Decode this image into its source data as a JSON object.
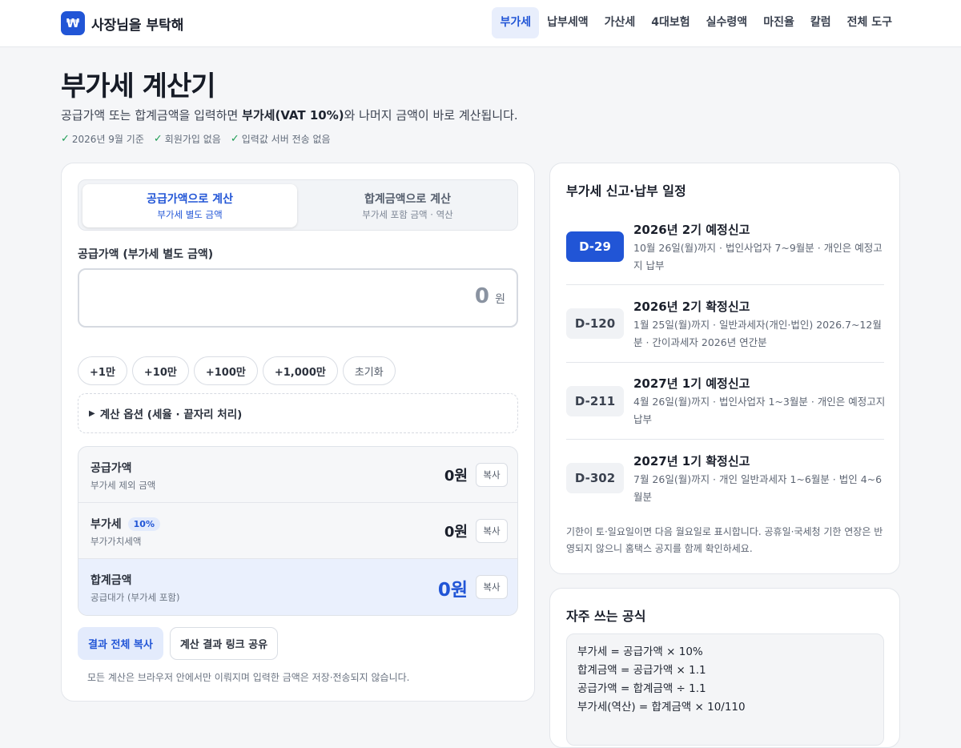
{
  "header": {
    "logo_glyph": "₩",
    "brand_name": "사장님을 부탁해",
    "nav": [
      "부가세",
      "납부세액",
      "가산세",
      "4대보험",
      "실수령액",
      "마진율",
      "칼럼",
      "전체 도구"
    ],
    "active_nav": "부가세"
  },
  "intro": {
    "title": "부가세 계산기",
    "desc_pre": "공급가액 또는 합계금액을 입력하면 ",
    "desc_bold": "부가세(VAT 10%)",
    "desc_post": "와 나머지 금액이 바로 계산됩니다.",
    "badges": [
      "2026년 9월 기준",
      "회원가입 없음",
      "입력값 서버 전송 없음"
    ]
  },
  "calculator": {
    "tabs": [
      {
        "title": "공급가액으로 계산",
        "sub": "부가세 별도 금액",
        "active": true
      },
      {
        "title": "합계금액으로 계산",
        "sub": "부가세 포함 금액 · 역산",
        "active": false
      }
    ],
    "field_label": "공급가액 (부가세 별도 금액)",
    "input_value": "",
    "input_placeholder": "0",
    "unit": "원",
    "quick_buttons": [
      "+1만",
      "+10만",
      "+100만",
      "+1,000만"
    ],
    "reset_label": "초기화",
    "options_label": "계산 옵션 (세율 · 끝자리 처리)",
    "results": [
      {
        "name": "공급가액",
        "sub": "부가세 제외 금액",
        "value": "0원",
        "copy": "복사"
      },
      {
        "name": "부가세",
        "rate": "10%",
        "sub": "부가가치세액",
        "value": "0원",
        "copy": "복사"
      },
      {
        "name": "합계금액",
        "sub": "공급대가 (부가세 포함)",
        "value": "0원",
        "copy": "복사"
      }
    ],
    "copy_all_label": "결과 전체 복사",
    "share_label": "계산 결과 링크 공유",
    "privacy_note": "모든 계산은 브라우저 안에서만 이뤄지며 입력한 금액은 저장·전송되지 않습니다."
  },
  "schedule": {
    "title": "부가세 신고·납부 일정",
    "items": [
      {
        "dday": "D-29",
        "name": "2026년 2기 예정신고",
        "desc": "10월 26일(월)까지 · 법인사업자 7~9월분 · 개인은 예정고지 납부",
        "highlight": true
      },
      {
        "dday": "D-120",
        "name": "2026년 2기 확정신고",
        "desc": "1월 25일(월)까지 · 일반과세자(개인·법인) 2026.7~12월분 · 간이과세자 2026년 연간분",
        "highlight": false
      },
      {
        "dday": "D-211",
        "name": "2027년 1기 예정신고",
        "desc": "4월 26일(월)까지 · 법인사업자 1~3월분 · 개인은 예정고지 납부",
        "highlight": false
      },
      {
        "dday": "D-302",
        "name": "2027년 1기 확정신고",
        "desc": "7월 26일(월)까지 · 개인 일반과세자 1~6월분 · 법인 4~6월분",
        "highlight": false
      }
    ],
    "note": "기한이 토·일요일이면 다음 월요일로 표시합니다. 공휴일·국세청 기한 연장은 반영되지 않으니 홈택스 공지를 함께 확인하세요."
  },
  "formulas": {
    "title": "자주 쓰는 공식",
    "lines": [
      "부가세 = 공급가액 × 10%",
      "합계금액 = 공급가액 × 1.1",
      "공급가액 = 합계금액 ÷ 1.1",
      "부가세(역산) = 합계금액 × 10/110"
    ]
  },
  "colors": {
    "accent": "#2155d6",
    "accent_soft": "#e8eefc",
    "check": "#1f9d55",
    "background": "#f5f6f8"
  }
}
